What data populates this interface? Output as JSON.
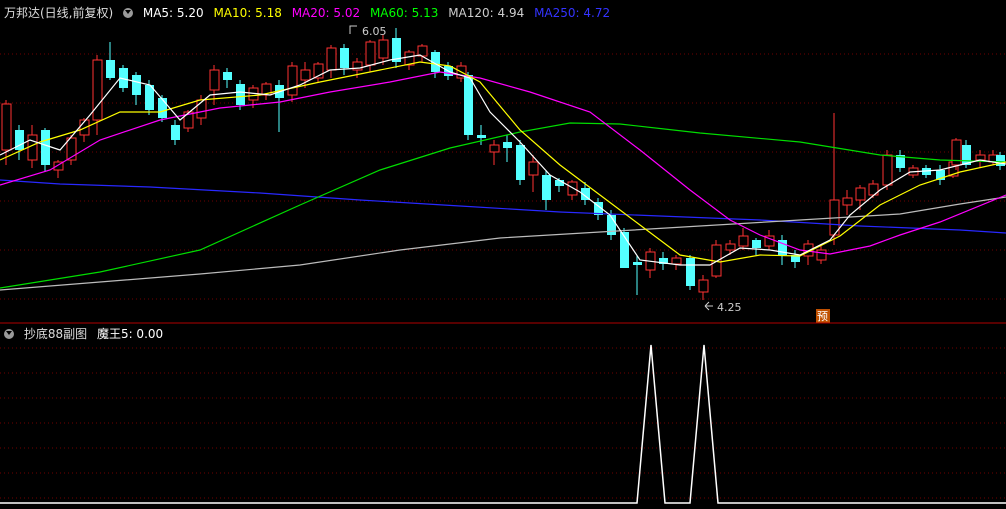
{
  "main_panel": {
    "title": "万邦达(日线,前复权)",
    "indicators": [
      {
        "label": "MA5: 5.20",
        "color": "#ffffff"
      },
      {
        "label": "MA10: 5.18",
        "color": "#ffff00"
      },
      {
        "label": "MA20: 5.02",
        "color": "#ff00ff"
      },
      {
        "label": "MA60: 5.13",
        "color": "#00ff00"
      },
      {
        "label": "MA120: 4.94",
        "color": "#cccccc"
      },
      {
        "label": "MA250: 4.72",
        "color": "#3333ff"
      }
    ],
    "high_label": "6.05",
    "low_label": "4.25",
    "forecast_badge": "预"
  },
  "sub_panel": {
    "title": "抄底88副图",
    "indicator_label": "魔王5: 0.00"
  },
  "colors": {
    "up": "#ff3232",
    "down": "#54ffff",
    "divider": "#b00000",
    "grid": "#800000",
    "signal": "#ffffff"
  }
}
